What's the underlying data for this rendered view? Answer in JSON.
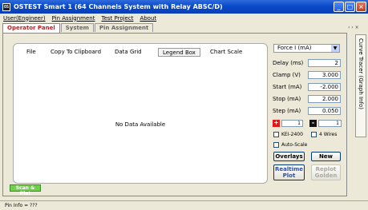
{
  "window": {
    "title": "OSTEST Smart 1 (64 Channels System with Relay ABSC/D)",
    "app_icon": "app-icon",
    "buttons": {
      "minimize": "_",
      "maximize": "□",
      "close": "×"
    }
  },
  "menu": [
    "User(Engineer)",
    "Pin Assignment",
    "Test Project",
    "About"
  ],
  "tabs": [
    "Operator Panel",
    "System",
    "Pin Assignment"
  ],
  "plot": {
    "menu": [
      "File",
      "Copy To Clipboard",
      "Data Grid",
      "Legend Box",
      "Chart Scale"
    ],
    "active_menu": "Legend Box",
    "empty_message": "No Data Available"
  },
  "controls": {
    "mode": "Force I (mA)",
    "fields": [
      {
        "label": "Delay (ms)",
        "value": "2"
      },
      {
        "label": "Clamp (V)",
        "value": "3.000"
      },
      {
        "label": "Start (mA)",
        "value": "-2.000"
      },
      {
        "label": "Stop (mA)",
        "value": "2.000"
      },
      {
        "label": "Step (mA)",
        "value": "0.050"
      }
    ],
    "plus_label": "+",
    "plus_value": "1",
    "minus_label": "-",
    "minus_value": "1",
    "checkboxes": [
      "KEI-2400",
      "4 Wires",
      "Auto-Scale"
    ],
    "buttons": {
      "overlays": "Overlays",
      "new": "New",
      "realtime_plot": [
        "Realtime",
        "Plot"
      ],
      "replot_golden": [
        "Replot",
        "Golden"
      ]
    },
    "scan_button": "Scan & Plot"
  },
  "side_tab": {
    "label": "Curve Tracer (Graph Info)",
    "controls": "‹ › ×"
  },
  "statusbar": "Pin Info = ???"
}
